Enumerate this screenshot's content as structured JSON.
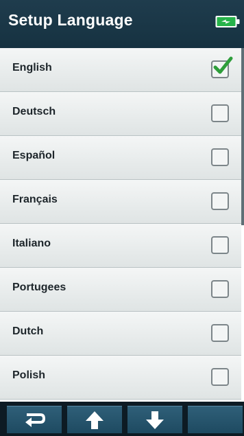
{
  "header": {
    "title": "Setup Language",
    "battery_icon": "battery-icon"
  },
  "languages": [
    {
      "label": "English",
      "checked": true
    },
    {
      "label": "Deutsch",
      "checked": false
    },
    {
      "label": "Español",
      "checked": false
    },
    {
      "label": "Français",
      "checked": false
    },
    {
      "label": "Italiano",
      "checked": false
    },
    {
      "label": "Portugees",
      "checked": false
    },
    {
      "label": "Dutch",
      "checked": false
    },
    {
      "label": "Polish",
      "checked": false
    }
  ],
  "toolbar": {
    "buttons": [
      {
        "icon": "return-icon"
      },
      {
        "icon": "arrow-up-icon"
      },
      {
        "icon": "arrow-down-icon"
      },
      {
        "icon": ""
      }
    ]
  },
  "colors": {
    "header": "#1f3c4d",
    "toolbar_button": "#2f5f78",
    "check": "#2e9e3b"
  }
}
